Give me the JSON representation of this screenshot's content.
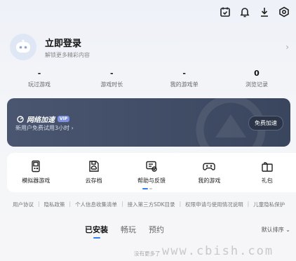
{
  "topbar": {
    "icons": [
      "calendar-check-icon",
      "bell-icon",
      "download-icon",
      "settings-hex-icon"
    ]
  },
  "profile": {
    "title": "立即登录",
    "subtitle": "解锁更多精彩内容"
  },
  "stats": [
    {
      "value": "-",
      "label": "玩过游戏"
    },
    {
      "value": "-",
      "label": "游戏时长"
    },
    {
      "value": "-",
      "label": "我的游戏单"
    },
    {
      "value": "0",
      "label": "浏览记录"
    }
  ],
  "speed": {
    "title": "网络加速",
    "badge": "VIP",
    "subtitle": "新用户免费试用3小时 ›",
    "button": "免费加速"
  },
  "tools": [
    {
      "label": "模拟器游戏",
      "icon": "gameboy-icon"
    },
    {
      "label": "云存档",
      "icon": "cloud-save-icon"
    },
    {
      "label": "帮助与反馈",
      "icon": "help-feedback-icon"
    },
    {
      "label": "我的游戏",
      "icon": "gamepad-icon"
    },
    {
      "label": "礼包",
      "icon": "gift-icon"
    }
  ],
  "links": [
    "用户协议",
    "隐私政策",
    "个人信息收集清单",
    "接入第三方SDK目录",
    "权限申请与使用情况说明",
    "儿童隐私保护"
  ],
  "tabs": [
    {
      "label": "已安装",
      "active": true
    },
    {
      "label": "畅玩",
      "active": false
    },
    {
      "label": "预约",
      "active": false
    }
  ],
  "sort": "默认排序 ⌄",
  "footer_note": "没有更多了",
  "watermark": "www.cbish.com",
  "colors": {
    "accent": "#2f7ef5",
    "card_bg": "#434f68"
  }
}
